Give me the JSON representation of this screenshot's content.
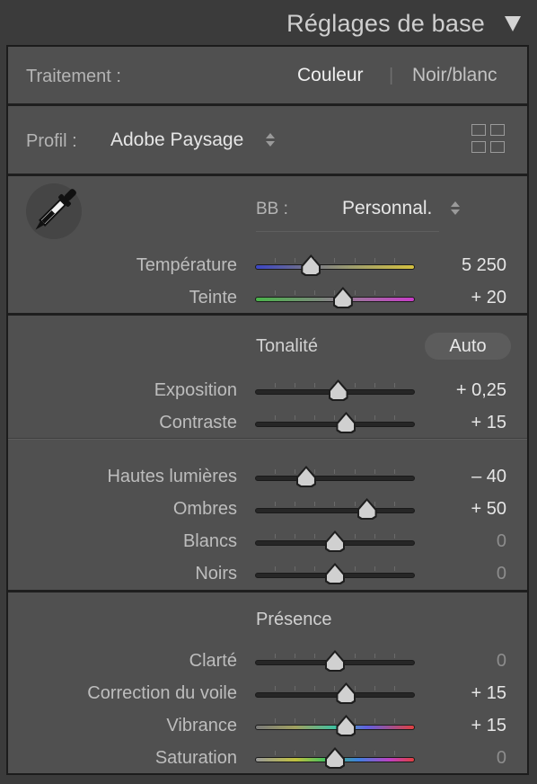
{
  "header": {
    "title": "Réglages de base"
  },
  "treatment": {
    "label": "Traitement :",
    "color": "Couleur",
    "divider": "|",
    "bw": "Noir/blanc"
  },
  "profile": {
    "label": "Profil :",
    "value": "Adobe Paysage"
  },
  "wb": {
    "label": "BB :",
    "value": "Personnal."
  },
  "sliders_wb": [
    {
      "label": "Température",
      "value": "5 250",
      "level": 0.35
    },
    {
      "label": "Teinte",
      "value": "+ 20",
      "level": 0.55
    }
  ],
  "tone": {
    "title": "Tonalité",
    "auto": "Auto"
  },
  "sliders_tone1": [
    {
      "label": "Exposition",
      "value": "+ 0,25",
      "level": 0.52
    },
    {
      "label": "Contraste",
      "value": "+ 15",
      "level": 0.57
    }
  ],
  "sliders_tone2": [
    {
      "label": "Hautes lumières",
      "value": "– 40",
      "level": 0.32
    },
    {
      "label": "Ombres",
      "value": "+ 50",
      "level": 0.7
    },
    {
      "label": "Blancs",
      "value": "0",
      "level": 0.5
    },
    {
      "label": "Noirs",
      "value": "0",
      "level": 0.5
    }
  ],
  "presence": {
    "title": "Présence"
  },
  "sliders_presence": [
    {
      "label": "Clarté",
      "value": "0",
      "level": 0.5
    },
    {
      "label": "Correction du voile",
      "value": "+ 15",
      "level": 0.57
    },
    {
      "label": "Vibrance",
      "value": "+ 15",
      "level": 0.57
    },
    {
      "label": "Saturation",
      "value": "0",
      "level": 0.5
    }
  ]
}
